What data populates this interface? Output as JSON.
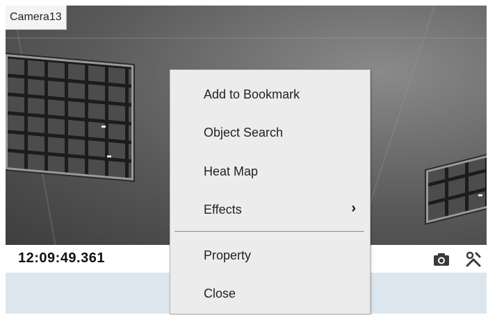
{
  "camera": {
    "name": "Camera13",
    "timestamp": "12:09:49.361"
  },
  "toolbar": {
    "icons": [
      "camera-snapshot-icon",
      "settings-tools-icon"
    ]
  },
  "context_menu": {
    "items": [
      {
        "label": "Add to Bookmark"
      },
      {
        "label": "Object Search"
      },
      {
        "label": "Heat Map"
      },
      {
        "label": "Effects",
        "submenu_indicator": "›"
      },
      {
        "label": "Property"
      },
      {
        "label": "Close"
      }
    ]
  },
  "colors": {
    "menu_background": "#ececec",
    "status_bar": "#ffffff",
    "panel_background": "#dce6ee"
  }
}
